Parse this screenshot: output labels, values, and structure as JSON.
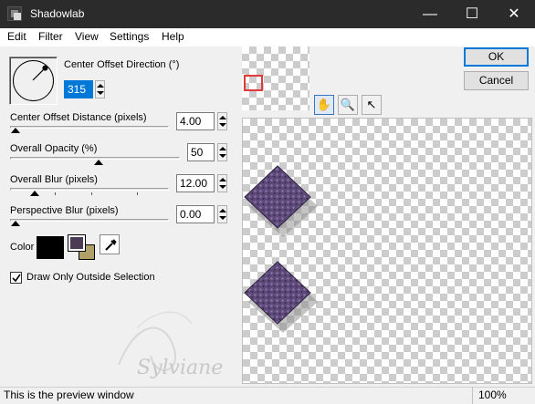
{
  "window": {
    "title": "Shadowlab",
    "controls": {
      "minimize": "—",
      "maximize": "☐",
      "close": "✕"
    }
  },
  "menu": [
    "Edit",
    "Filter",
    "View",
    "Settings",
    "Help"
  ],
  "direction": {
    "label": "Center Offset Direction (°)",
    "value": "315",
    "dial_angle_deg": 315
  },
  "offset_distance": {
    "label": "Center Offset Distance (pixels)",
    "value": "4.00"
  },
  "opacity": {
    "label": "Overall Opacity (%)",
    "value": "50"
  },
  "blur": {
    "label": "Overall Blur (pixels)",
    "value": "12.00"
  },
  "perspective_blur": {
    "label": "Perspective Blur (pixels)",
    "value": "0.00"
  },
  "color": {
    "label": "Color",
    "primary": "#000000",
    "secondary_fg": "#4b3b55",
    "secondary_bg": "#b0a068"
  },
  "checkbox": {
    "label": "Draw Only Outside Selection",
    "checked": true
  },
  "buttons": {
    "ok": "OK",
    "cancel": "Cancel"
  },
  "tools": {
    "pan": "hand-icon",
    "zoom": "magnifier-icon",
    "select": "arrow-icon"
  },
  "watermark": "Sylviane",
  "status": {
    "text": "This is the preview window",
    "zoom": "100%"
  },
  "colors": {
    "accent": "#0078d7",
    "diamond": "#5e4a7a",
    "viewport": "#e03a3a"
  }
}
